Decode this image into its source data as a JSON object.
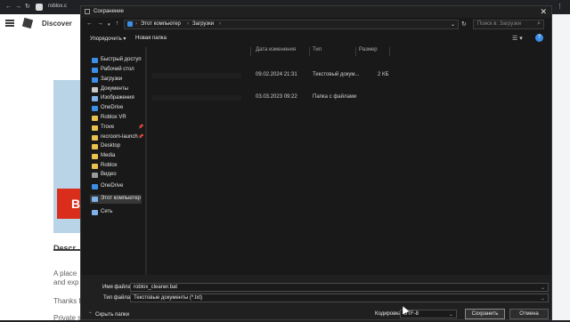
{
  "browser": {
    "url": "roblox.c",
    "discover": "Discover",
    "desc_title": "Descr",
    "desc_line1": "A place",
    "desc_line2": "and exp",
    "desc_line3": "Thanks f",
    "desc_line4": "Private s",
    "thumb_letter": "B"
  },
  "dialog": {
    "title": "Сохранение",
    "path": [
      "Этот компьютер",
      "Загрузки"
    ],
    "search_placeholder": "Поиск в: Загрузки",
    "toolbar": {
      "organize": "Упорядочить ▾",
      "new_folder": "Новая папка"
    },
    "nav": [
      {
        "label": "Быстрый доступ",
        "icon": "star-icon",
        "color": "#3b8fe6"
      },
      {
        "label": "Рабочий стол",
        "icon": "desktop-icon",
        "color": "#3b8fe6"
      },
      {
        "label": "Загрузки",
        "icon": "download-icon",
        "color": "#3b8fe6"
      },
      {
        "label": "Документы",
        "icon": "documents-icon",
        "color": "#c9c9c9"
      },
      {
        "label": "Изображения",
        "icon": "pictures-icon",
        "color": "#7fb3e8"
      },
      {
        "label": "OneDrive",
        "icon": "cloud-icon",
        "color": "#3b8fe6"
      },
      {
        "label": "Roblox VR",
        "icon": "folder-icon",
        "color": "#e8c14f"
      },
      {
        "label": "Trove",
        "icon": "folder-icon",
        "color": "#e8c14f"
      },
      {
        "label": "recroom-launch",
        "icon": "folder-icon",
        "color": "#e8c14f"
      },
      {
        "label": "Desktop",
        "icon": "folder-icon",
        "color": "#e8c14f"
      },
      {
        "label": "Media",
        "icon": "folder-icon",
        "color": "#e8c14f"
      },
      {
        "label": "Roblox",
        "icon": "folder-icon",
        "color": "#e8c14f"
      },
      {
        "label": "Видео",
        "icon": "video-icon",
        "color": "#9a9a9a"
      },
      {
        "label": "OneDrive",
        "icon": "cloud-icon",
        "color": "#3b8fe6"
      },
      {
        "label": "Этот компьютер",
        "icon": "computer-icon",
        "color": "#7fb3e8"
      },
      {
        "label": "Сеть",
        "icon": "network-icon",
        "color": "#7fb3e8"
      }
    ],
    "columns": {
      "date": "Дата изменения",
      "type": "Тип",
      "size": "Размер"
    },
    "rows": [
      {
        "date": "09.02.2024 21:31",
        "type": "Текстовый докум...",
        "size": "2 КБ"
      },
      {
        "date": "03.03.2023 09:22",
        "type": "Папка с файлами",
        "size": ""
      }
    ],
    "filename_label": "Имя файла:",
    "filename_value": "roblox_cleaner.bat",
    "filetype_label": "Тип файла:",
    "filetype_value": "Текстовые документы (*.txt)",
    "hide_folders": "Скрыть папки",
    "encoding_label": "Кодировка:",
    "encoding_value": "UTF-8",
    "save": "Сохранить",
    "cancel": "Отмена"
  }
}
